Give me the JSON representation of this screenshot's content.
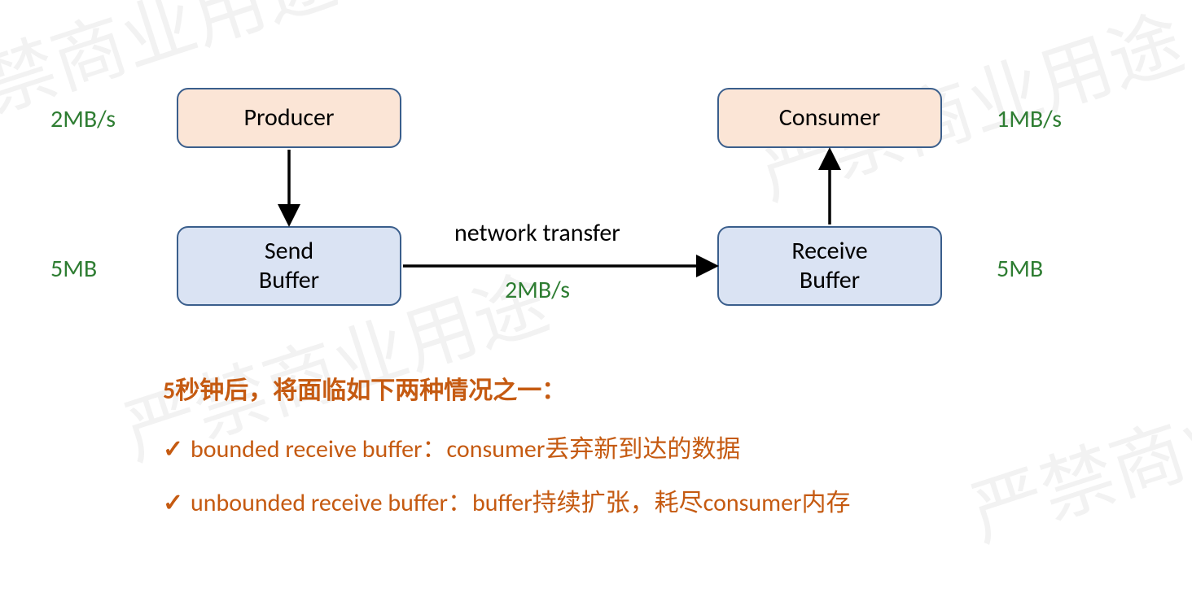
{
  "rates": {
    "producer_rate": "2MB/s",
    "consumer_rate": "1MB/s",
    "send_buf_size": "5MB",
    "recv_buf_size": "5MB",
    "network_label": "network transfer",
    "network_rate": "2MB/s"
  },
  "boxes": {
    "producer": "Producer",
    "consumer": "Consumer",
    "send_buffer_l1": "Send",
    "send_buffer_l2": "Buffer",
    "recv_buffer_l1": "Receive",
    "recv_buffer_l2": "Buffer"
  },
  "notes": {
    "heading": "5秒钟后，将面临如下两种情况之一：",
    "item1": "bounded receive buffer：consumer丢弃新到达的数据",
    "item2": "unbounded receive buffer：buffer持续扩张，耗尽consumer内存"
  },
  "watermark_text": "严禁商业用途"
}
